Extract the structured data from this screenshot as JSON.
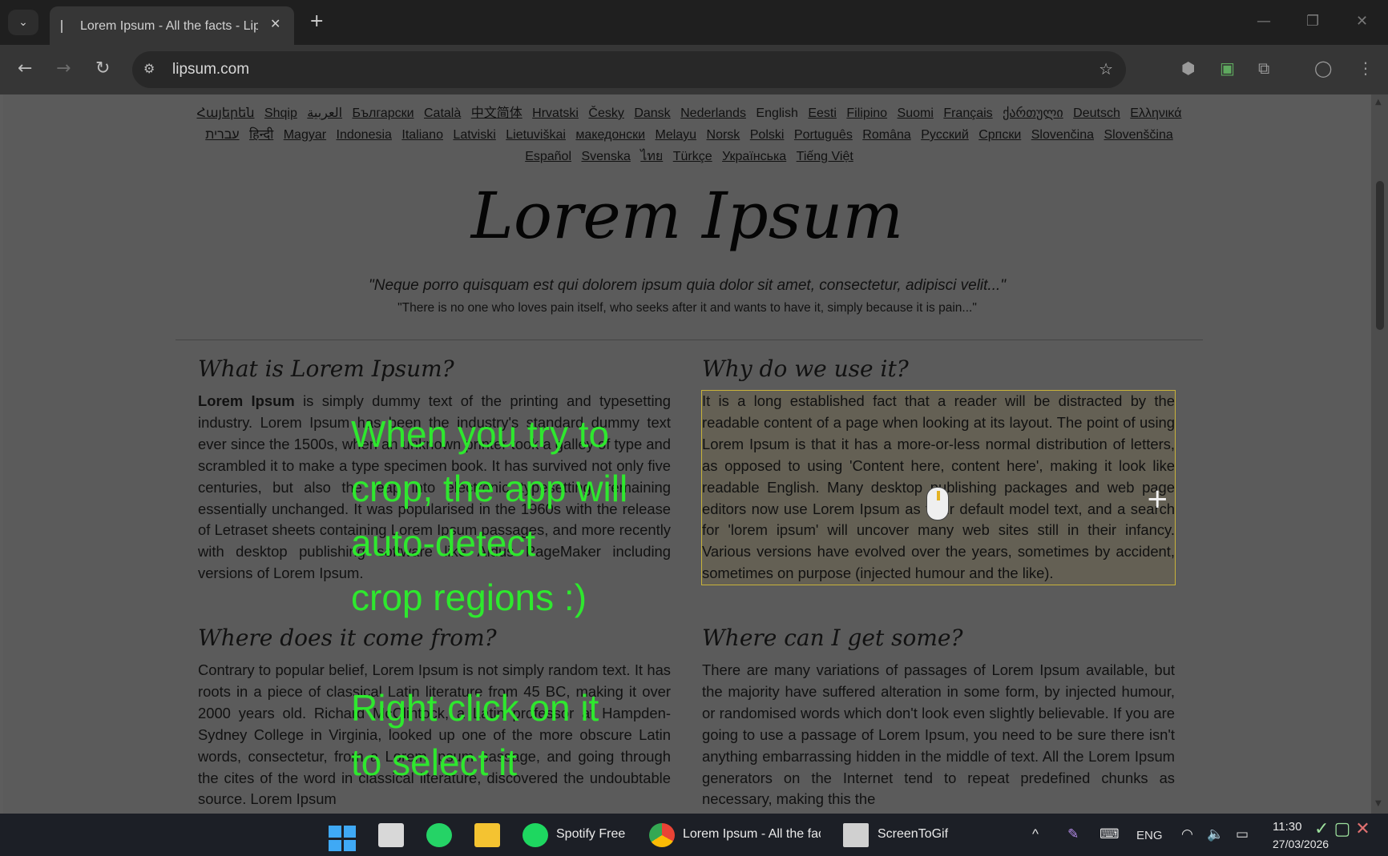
{
  "browser": {
    "tab_title": "Lorem Ipsum - All the facts - Lipsum generator",
    "tab_close": "✕",
    "new_tab": "+",
    "tab_search": "⌄",
    "window_controls": [
      "—",
      "❐",
      "✕"
    ],
    "nav": {
      "back": "←",
      "forward": "→",
      "reload": "↻"
    },
    "url": "lipsum.com",
    "site_info_icon": "⚙",
    "bookmark_icon": "☆",
    "toolbar_icons": [
      "⬢",
      "▣",
      "⧉",
      "◯",
      "⋮"
    ]
  },
  "languages": [
    {
      "label": "Հայերեն",
      "current": false
    },
    {
      "label": "Shqip",
      "current": false
    },
    {
      "label": "العربية",
      "current": false
    },
    {
      "label": "Български",
      "current": false
    },
    {
      "label": "Català",
      "current": false
    },
    {
      "label": "中文简体",
      "current": false
    },
    {
      "label": "Hrvatski",
      "current": false
    },
    {
      "label": "Česky",
      "current": false
    },
    {
      "label": "Dansk",
      "current": false
    },
    {
      "label": "Nederlands",
      "current": false
    },
    {
      "label": "English",
      "current": true
    },
    {
      "label": "Eesti",
      "current": false
    },
    {
      "label": "Filipino",
      "current": false
    },
    {
      "label": "Suomi",
      "current": false
    },
    {
      "label": "Français",
      "current": false
    },
    {
      "label": "ქართული",
      "current": false
    },
    {
      "label": "Deutsch",
      "current": false
    },
    {
      "label": "Ελληνικά",
      "current": false
    },
    {
      "label": "עברית",
      "current": false
    },
    {
      "label": "हिन्दी",
      "current": false
    },
    {
      "label": "Magyar",
      "current": false
    },
    {
      "label": "Indonesia",
      "current": false
    },
    {
      "label": "Italiano",
      "current": false
    },
    {
      "label": "Latviski",
      "current": false
    },
    {
      "label": "Lietuviškai",
      "current": false
    },
    {
      "label": "македонски",
      "current": false
    },
    {
      "label": "Melayu",
      "current": false
    },
    {
      "label": "Norsk",
      "current": false
    },
    {
      "label": "Polski",
      "current": false
    },
    {
      "label": "Português",
      "current": false
    },
    {
      "label": "Româna",
      "current": false
    },
    {
      "label": "Pyccкий",
      "current": false
    },
    {
      "label": "Српски",
      "current": false
    },
    {
      "label": "Slovenčina",
      "current": false
    },
    {
      "label": "Slovenščina",
      "current": false
    },
    {
      "label": "Español",
      "current": false
    },
    {
      "label": "Svenska",
      "current": false
    },
    {
      "label": "ไทย",
      "current": false
    },
    {
      "label": "Türkçe",
      "current": false
    },
    {
      "label": "Українська",
      "current": false
    },
    {
      "label": "Tiếng Việt",
      "current": false
    }
  ],
  "page": {
    "logo": "Lorem Ipsum",
    "quote_latin": "\"Neque porro quisquam est qui dolorem ipsum quia dolor sit amet, consectetur, adipisci velit...\"",
    "quote_english": "\"There is no one who loves pain itself, who seeks after it and wants to have it, simply because it is pain...\"",
    "sections": {
      "what": {
        "heading": "What is Lorem Ipsum?",
        "lead": "Lorem Ipsum",
        "body": " is simply dummy text of the printing and typesetting industry. Lorem Ipsum has been the industry's standard dummy text ever since the 1500s, when an unknown printer took a galley of type and scrambled it to make a type specimen book. It has survived not only five centuries, but also the leap into electronic typesetting, remaining essentially unchanged. It was popularised in the 1960s with the release of Letraset sheets containing Lorem Ipsum passages, and more recently with desktop publishing software like Aldus PageMaker including versions of Lorem Ipsum."
      },
      "why": {
        "heading": "Why do we use it?",
        "body": "It is a long established fact that a reader will be distracted by the readable content of a page when looking at its layout. The point of using Lorem Ipsum is that it has a more-or-less normal distribution of letters, as opposed to using 'Content here, content here', making it look like readable English. Many desktop publishing packages and web page editors now use Lorem Ipsum as their default model text, and a search for 'lorem ipsum' will uncover many web sites still in their infancy. Various versions have evolved over the years, sometimes by accident, sometimes on purpose (injected humour and the like)."
      },
      "where_from": {
        "heading": "Where does it come from?",
        "body": "Contrary to popular belief, Lorem Ipsum is not simply random text. It has roots in a piece of classical Latin literature from 45 BC, making it over 2000 years old. Richard McClintock, a Latin professor at Hampden-Sydney College in Virginia, looked up one of the more obscure Latin words, consectetur, from a Lorem Ipsum passage, and going through the cites of the word in classical literature, discovered the undoubtable source. Lorem Ipsum"
      },
      "where_get": {
        "heading": "Where can I get some?",
        "body": "There are many variations of passages of Lorem Ipsum available, but the majority have suffered alteration in some form, by injected humour, or randomised words which don't look even slightly believable. If you are going to use a passage of Lorem Ipsum, you need to be sure there isn't anything embarrassing hidden in the middle of text. All the Lorem Ipsum generators on the Internet tend to repeat predefined chunks as necessary, making this the"
      }
    }
  },
  "overlays": {
    "text1": "When you try to\ncrop, the app will\nauto-detect\ncrop regions :)",
    "text2": "Right click on it\nto select it",
    "crosshair": "+"
  },
  "taskbar": {
    "spotify_label": "Spotify Free",
    "chrome_label": "Lorem Ipsum - All the facts - Lipsum generator",
    "screentogif_label": "ScreenToGif",
    "tray_chevron": "^",
    "tray_language": "ENG",
    "tray_wifi": "◠",
    "tray_volume": "🔈",
    "tray_battery": "▭",
    "time": "11:30",
    "date": "27/03/2026",
    "stg_controls": [
      "✓",
      "▢",
      "✕"
    ]
  },
  "colors": {
    "overlay_green": "#2ee82e",
    "selection_outline": "#c9b33a"
  }
}
